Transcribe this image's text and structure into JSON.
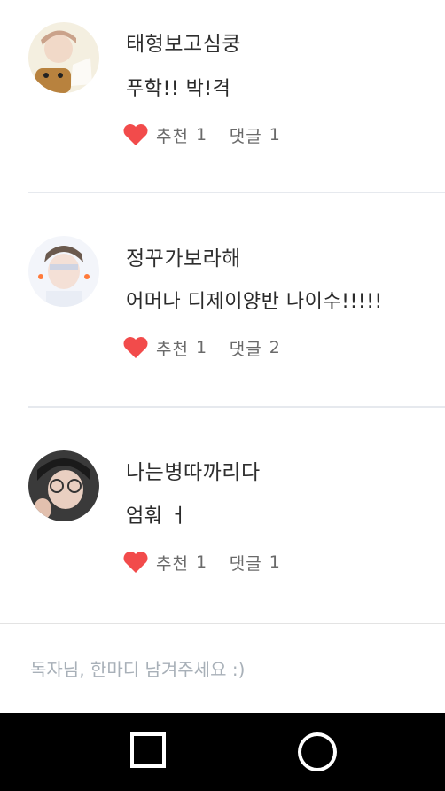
{
  "comments": [
    {
      "name": "태형보고심쿵",
      "text": "푸학!! 박!격",
      "like_label": "추천",
      "like_count": "1",
      "reply_label": "댓글",
      "reply_count": "1"
    },
    {
      "name": "정꾸가보라해",
      "text": "어머나 디제이양반 나이수!!!!!",
      "like_label": "추천",
      "like_count": "1",
      "reply_label": "댓글",
      "reply_count": "2"
    },
    {
      "name": "나는병따까리다",
      "text": "엄훠 ㅓ",
      "like_label": "추천",
      "like_count": "1",
      "reply_label": "댓글",
      "reply_count": "1"
    }
  ],
  "comment_input": {
    "placeholder": "독자님, 한마디 남겨주세요 :)"
  },
  "colors": {
    "heart": "#f24b4b",
    "divider": "#e6e9ee",
    "placeholder": "#a8b0b8",
    "navbar": "#000000"
  },
  "icons": {
    "like": "heart-icon",
    "nav_left": "square-icon",
    "nav_right": "circle-icon"
  }
}
